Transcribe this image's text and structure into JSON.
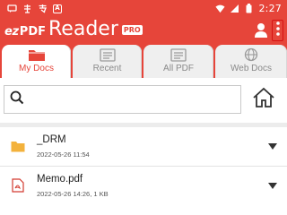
{
  "status_bar": {
    "time": "2:27",
    "left_icons": [
      "android-message-icon",
      "chinese-char-icon",
      "chinese-char-icon",
      "a-box-icon"
    ],
    "right_icons": [
      "wifi-icon",
      "signal-icon",
      "battery-icon"
    ]
  },
  "app_bar": {
    "logo_ez": "ez",
    "logo_pdf": "PDF",
    "logo_reader": "Reader",
    "logo_pro": "PRO",
    "user_icon": "user-icon",
    "menu_icon": "more-vert-icon"
  },
  "tabs": [
    {
      "label": "My Docs",
      "icon": "folder-icon",
      "active": true
    },
    {
      "label": "Recent",
      "icon": "recent-list-icon",
      "active": false
    },
    {
      "label": "All PDF",
      "icon": "pdf-list-icon",
      "active": false
    },
    {
      "label": "Web Docs",
      "icon": "globe-icon",
      "active": false
    }
  ],
  "search": {
    "placeholder": "",
    "value": "",
    "search_icon": "search-icon",
    "home_icon": "home-icon"
  },
  "files": [
    {
      "name": "_DRM",
      "meta": "2022-05-26 11:54",
      "type": "folder",
      "icon": "folder-icon"
    },
    {
      "name": "Memo.pdf",
      "meta": "2022-05-26 14:26, 1 KB",
      "type": "pdf",
      "icon": "pdf-file-icon"
    }
  ],
  "colors": {
    "brand": "#e6453a",
    "active_tab_text": "#e6453a",
    "inactive_tab_bg": "#efefef",
    "folder": "#f3b23c",
    "menu_highlight": "#d61212"
  }
}
